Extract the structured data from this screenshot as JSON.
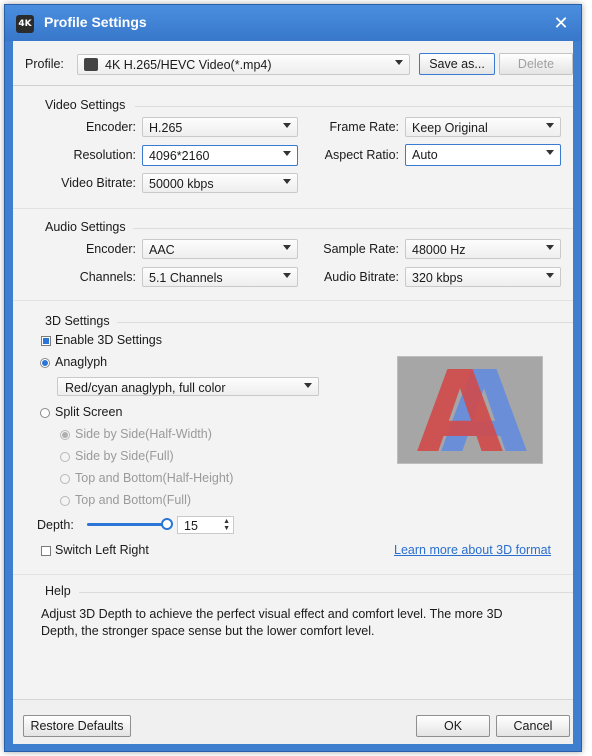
{
  "window": {
    "title": "Profile Settings",
    "app_icon": "4K",
    "close_icon": "✕"
  },
  "profile": {
    "label": "Profile:",
    "value": "4K H.265/HEVC Video(*.mp4)",
    "save_as": "Save as...",
    "delete": "Delete"
  },
  "video": {
    "title": "Video Settings",
    "encoder_label": "Encoder:",
    "encoder": "H.265",
    "frame_rate_label": "Frame Rate:",
    "frame_rate": "Keep Original",
    "resolution_label": "Resolution:",
    "resolution": "4096*2160",
    "aspect_label": "Aspect Ratio:",
    "aspect": "Auto",
    "bitrate_label": "Video Bitrate:",
    "bitrate": "50000 kbps"
  },
  "audio": {
    "title": "Audio Settings",
    "encoder_label": "Encoder:",
    "encoder": "AAC",
    "sample_rate_label": "Sample Rate:",
    "sample_rate": "48000 Hz",
    "channels_label": "Channels:",
    "channels": "5.1 Channels",
    "bitrate_label": "Audio Bitrate:",
    "bitrate": "320 kbps"
  },
  "three_d": {
    "title": "3D Settings",
    "enable": "Enable 3D Settings",
    "anaglyph": "Anaglyph",
    "anaglyph_mode": "Red/cyan anaglyph, full color",
    "split_screen": "Split Screen",
    "side_half": "Side by Side(Half-Width)",
    "side_full": "Side by Side(Full)",
    "top_half": "Top and Bottom(Half-Height)",
    "top_full": "Top and Bottom(Full)",
    "depth_label": "Depth:",
    "depth_value": "15",
    "depth_fraction": 1.0,
    "switch": "Switch Left Right",
    "learn_more": "Learn more about 3D format",
    "preview_letter": "A"
  },
  "help": {
    "title": "Help",
    "text1": "Adjust 3D Depth to achieve the perfect visual effect and comfort level. The more 3D",
    "text2": "Depth, the stronger space sense but the lower comfort level."
  },
  "footer": {
    "restore": "Restore Defaults",
    "ok": "OK",
    "cancel": "Cancel"
  },
  "colors": {
    "title_bar": "#3f7fd0",
    "accent": "#2a75d6",
    "link": "#2a6fcf",
    "anaglyph_red": "#d24a4a",
    "anaglyph_blue": "#6a8fd8"
  }
}
